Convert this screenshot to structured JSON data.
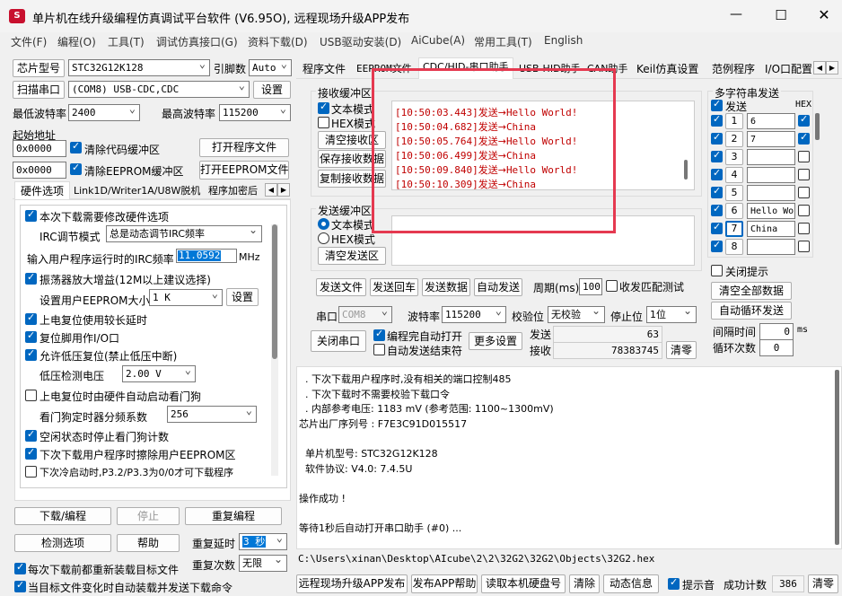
{
  "title": "单片机在线升级编程仿真调试平台软件 (V6.95O), 远程现场升级APP发布",
  "menu": [
    "文件(F)",
    "编程(O)",
    "工具(T)",
    "调试仿真接口(G)",
    "资料下载(D)",
    "USB驱动安装(D)",
    "AiCube(A)",
    "常用工具(T)",
    "English"
  ],
  "left": {
    "chip_label": "芯片型号",
    "chip_value": "STC32G12K128",
    "pins_label": "引脚数",
    "pins_value": "Auto",
    "scan_btn": "扫描串口",
    "port_value": "(COM8) USB-CDC,CDC",
    "settings_btn": "设置",
    "min_baud_label": "最低波特率",
    "min_baud_value": "2400",
    "max_baud_label": "最高波特率",
    "max_baud_value": "115200",
    "start_addr_label": "起始地址",
    "addr1": "0x0000",
    "clear_code": "清除代码缓冲区",
    "open_prog_btn": "打开程序文件",
    "addr2": "0x0000",
    "clear_eeprom": "清除EEPROM缓冲区",
    "open_eeprom_btn": "打开EEPROM文件",
    "tabs": [
      "硬件选项",
      "Link1D/Writer1A/U8W脱机",
      "程序加密后"
    ],
    "hw": {
      "modify_hw": "本次下载需要修改硬件选项",
      "irc_mode_label": "IRC调节模式",
      "irc_mode_value": "总是动态调节IRC频率",
      "freq_label": "输入用户程序运行时的IRC频率",
      "freq_value": "11.0592",
      "freq_unit": "MHz",
      "osc_gain": "振荡器放大增益(12M以上建议选择)",
      "eeprom_size_label": "设置用户EEPROM大小",
      "eeprom_size_value": "1  K",
      "eeprom_set_btn": "设置",
      "long_delay": "上电复位使用较长延时",
      "reset_io": "复位脚用作I/O口",
      "lvr": "允许低压复位(禁止低压中断)",
      "lvd_label": "低压检测电压",
      "lvd_value": "2.00 V",
      "wdt_auto": "上电复位时由硬件自动启动看门狗",
      "wdt_div_label": "看门狗定时器分频系数",
      "wdt_div_value": "256",
      "idle_wdt": "空闲状态时停止看门狗计数",
      "erase_eeprom": "下次下载用户程序时擦除用户EEPROM区",
      "cold_boot": "下次冷启动时,P3.2/P3.3为0/0才可下载程序"
    },
    "download_btn": "下载/编程",
    "stop_btn": "停止",
    "reprog_btn": "重复编程",
    "check_btn": "检测选项",
    "help_btn": "帮助",
    "delay_label": "重复延时",
    "delay_value": "3 秒",
    "reload_each": "每次下载前都重新装载目标文件",
    "count_label": "重复次数",
    "count_value": "无限",
    "auto_load": "当目标文件变化时自动装载并发送下载命令"
  },
  "tabs_right": [
    "程序文件",
    "EEPROM文件",
    "CDC/HID-串口助手",
    "USB-HID助手",
    "CAN助手",
    "Keil仿真设置",
    "范例程序",
    "I/O口配置"
  ],
  "recv": {
    "group": "接收缓冲区",
    "text_mode": "文本模式",
    "hex_mode": "HEX模式",
    "clear_btn": "清空接收区",
    "save_btn": "保存接收数据",
    "copy_btn": "复制接收数据",
    "lines": [
      {
        "time": "[10:50:03.443]",
        "dir": "发送→",
        "msg": "Hello World!"
      },
      {
        "time": "[10:50:04.682]",
        "dir": "发送→",
        "msg": "China"
      },
      {
        "time": "[10:50:05.764]",
        "dir": "发送→",
        "msg": "Hello World!"
      },
      {
        "time": "[10:50:06.499]",
        "dir": "发送→",
        "msg": "China"
      },
      {
        "time": "[10:50:09.840]",
        "dir": "发送→",
        "msg": "Hello World!"
      },
      {
        "time": "[10:50:10.309]",
        "dir": "发送→",
        "msg": "China"
      }
    ]
  },
  "send": {
    "group": "发送缓冲区",
    "text_mode": "文本模式",
    "hex_mode": "HEX模式",
    "clear_btn": "清空发送区",
    "send_file": "发送文件",
    "send_enter": "发送回车",
    "send_data": "发送数据",
    "auto_send": "自动发送",
    "period_label": "周期(ms)",
    "period_value": "100",
    "recv_match": "收发匹配测试"
  },
  "serial": {
    "port_label": "串口",
    "port_value": "COM8",
    "baud_label": "波特率",
    "baud_value": "115200",
    "check_label": "校验位",
    "check_value": "无校验",
    "stop_label": "停止位",
    "stop_value": "1位",
    "close_btn": "关闭串口",
    "auto_open": "编程完自动打开",
    "auto_end": "自动发送结束符",
    "more_btn": "更多设置",
    "send_label": "发送",
    "send_count": "63",
    "recv_label": "接收",
    "recv_count": "78383745",
    "clear_btn": "清零"
  },
  "multi": {
    "group": "多字符串发送",
    "send_col": "发送",
    "hex_col": "HEX",
    "rows": [
      {
        "n": "1",
        "text": "6"
      },
      {
        "n": "2",
        "text": "7"
      },
      {
        "n": "3",
        "text": ""
      },
      {
        "n": "4",
        "text": ""
      },
      {
        "n": "5",
        "text": ""
      },
      {
        "n": "6",
        "text": "Hello Wo:"
      },
      {
        "n": "7",
        "text": "China"
      },
      {
        "n": "8",
        "text": ""
      }
    ],
    "close_tip": "关闭提示",
    "clear_all": "清空全部数据",
    "auto_loop": "自动循环发送",
    "interval_label": "间隔时间",
    "interval_value": "0",
    "interval_unit": "ms",
    "loop_label": "循环次数",
    "loop_value": "0"
  },
  "log": [
    "  . 下次下载用户程序时,没有相关的端口控制485",
    "  . 下次下载时不需要校验下载口令",
    "  . 内部参考电压: 1183 mV (参考范围: 1100~1300mV)",
    "芯片出厂序列号 : F7E3C91D015517",
    "",
    "  单片机型号: STC32G12K128",
    "  软件协议: V4.0: 7.4.5U",
    "",
    "操作成功 !",
    "",
    "等待1秒后自动打开串口助手 (#0) ..."
  ],
  "filepath": "C:\\Users\\xinan\\Desktop\\AIcube\\2\\2\\32G2\\32G2\\Objects\\32G2.hex",
  "bottom": {
    "remote_btn": "远程现场升级APP发布",
    "publish_help": "发布APP帮助",
    "read_disk": "读取本机硬盘号",
    "clear_btn": "清除",
    "dyn_info": "动态信息",
    "beep": "提示音",
    "success_label": "成功计数",
    "success_value": "386",
    "reset_btn": "清零"
  },
  "colors": {
    "accent": "#0067c0",
    "recv_text": "#c00000",
    "highlight": "#e53950"
  }
}
